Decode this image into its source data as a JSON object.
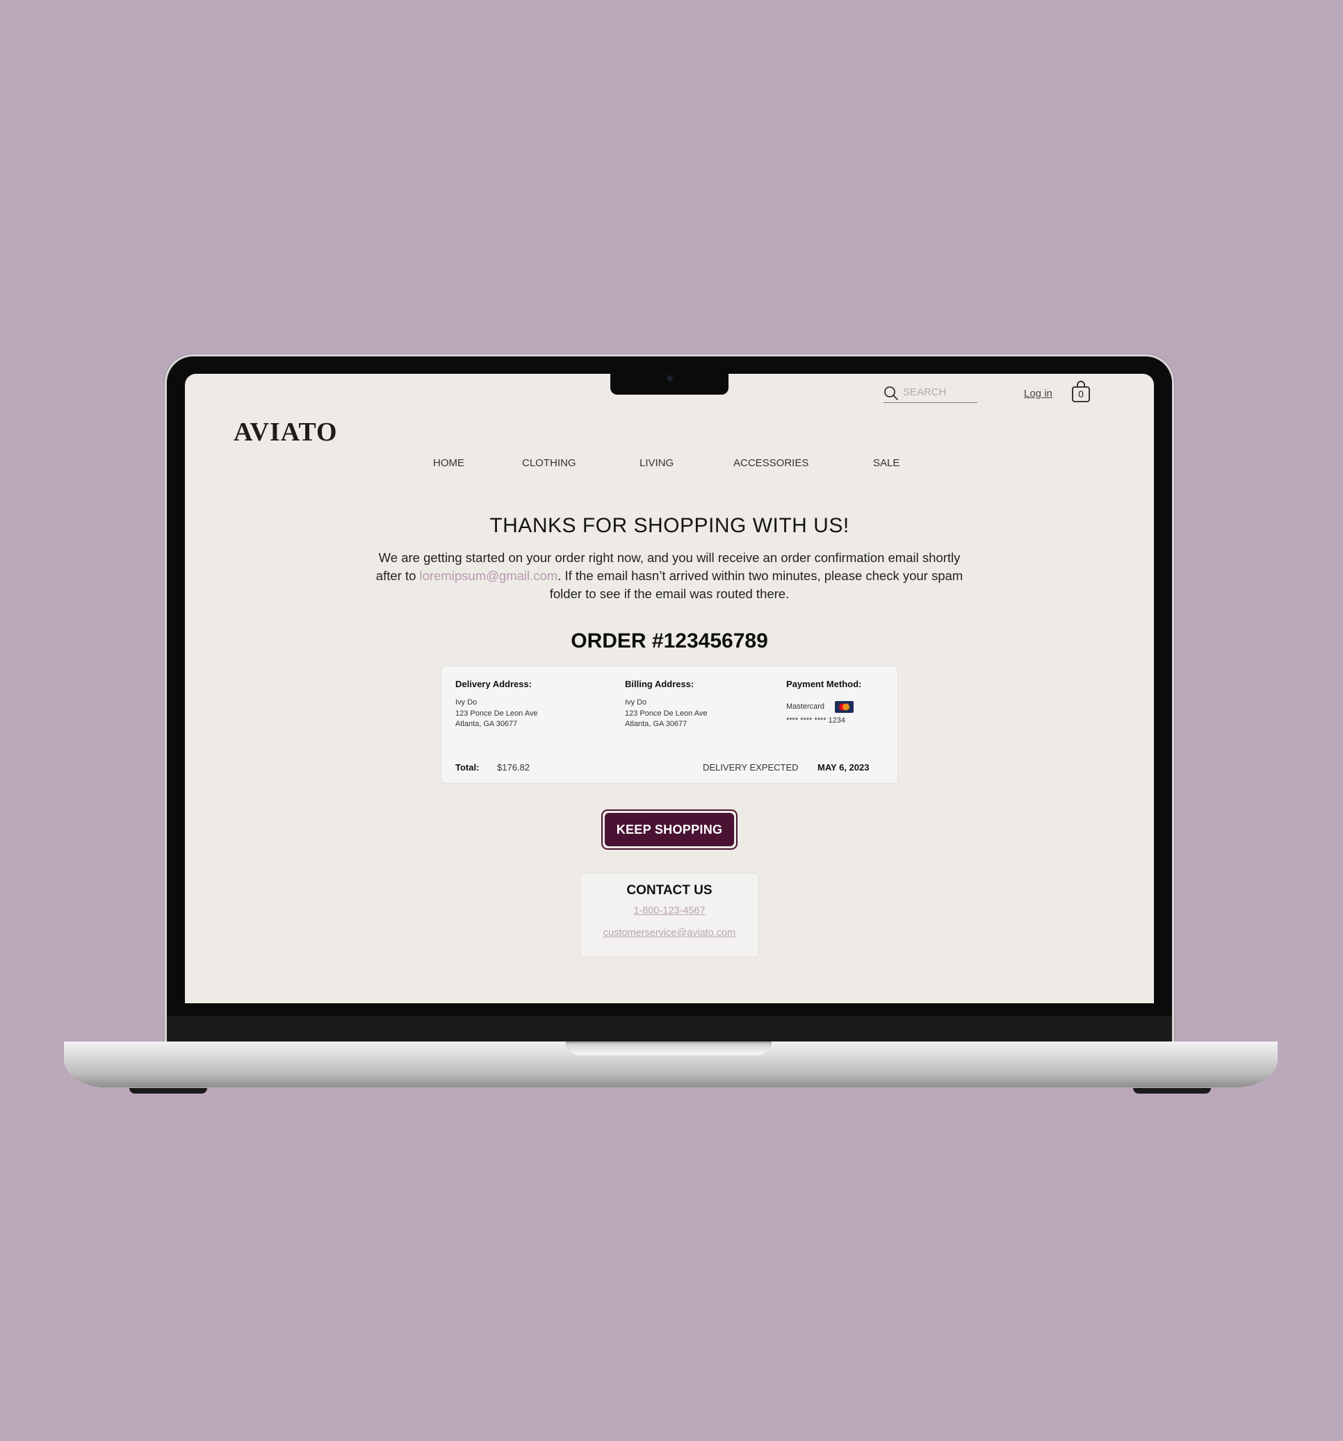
{
  "colors": {
    "background": "#bba8bb",
    "page": "#eeebe6",
    "accent": "#4a1232",
    "link": "#b59aae"
  },
  "header": {
    "logo": "AVIATO",
    "search_placeholder": "SEARCH",
    "login_label": "Log in",
    "cart_count": "0"
  },
  "nav": {
    "items": [
      "HOME",
      "CLOTHING",
      "LIVING",
      "ACCESSORIES",
      "SALE"
    ]
  },
  "confirmation": {
    "title": "THANKS FOR SHOPPING WITH US!",
    "body_before": "We are getting started on your order right now, and you will receive an order confirmation email shortly after to ",
    "email": "loremipsum@gmail.com",
    "body_after": ". If the email hasn’t arrived within two minutes, please check your spam folder to see if the email was routed there.",
    "order_title": "ORDER #123456789"
  },
  "order": {
    "delivery": {
      "label": "Delivery Address:",
      "name": "Ivy Do",
      "street": "123 Ponce De Leon Ave",
      "city": "Atlanta, GA 30677"
    },
    "billing": {
      "label": "Billing Address:",
      "name": "Ivy Do",
      "street": "123 Ponce De Leon Ave",
      "city": "Atlanta, GA 30677"
    },
    "payment": {
      "label": "Payment Method:",
      "card_type": "Mastercard",
      "card_number": "**** **** **** 1234",
      "card_icon": "mastercard-icon"
    },
    "total_label": "Total:",
    "total_value": "$176.82",
    "delivery_label": "DELIVERY EXPECTED",
    "delivery_date": "MAY 6, 2023"
  },
  "keep_shopping_label": "KEEP SHOPPING",
  "contact": {
    "title": "CONTACT US",
    "phone": "1-800-123-4567",
    "email": "customerservice@aviato.com"
  }
}
